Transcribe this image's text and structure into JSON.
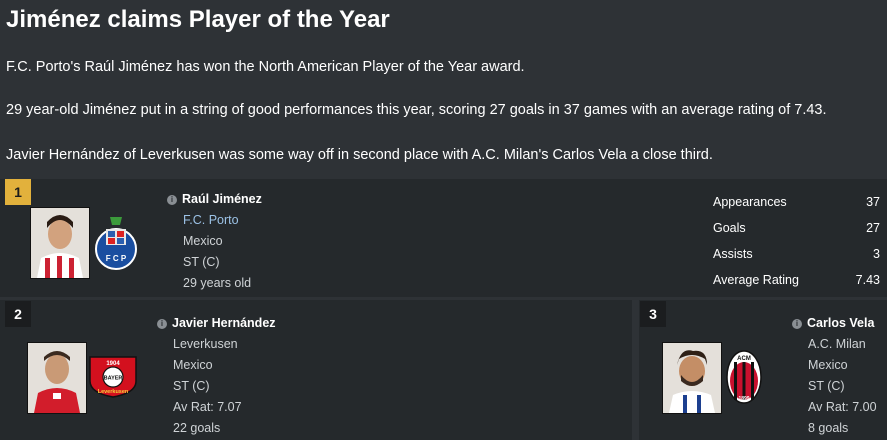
{
  "article": {
    "headline": "Jiménez claims Player of the Year",
    "paragraphs": [
      "F.C. Porto's Raúl Jiménez has won the North American Player of the Year award.",
      "29 year-old Jiménez put in a string of good performances this year, scoring 27 goals in 37 games with an average rating of 7.43.",
      "Javier Hernández of Leverkusen was some way off in second place with A.C. Milan's Carlos Vela a close third."
    ]
  },
  "winner": {
    "rank": "1",
    "name": "Raúl Jiménez",
    "club": "F.C. Porto",
    "nation": "Mexico",
    "position": "ST (C)",
    "age": "29 years old",
    "stats": [
      {
        "label": "Appearances",
        "value": "37"
      },
      {
        "label": "Goals",
        "value": "27"
      },
      {
        "label": "Assists",
        "value": "3"
      },
      {
        "label": "Average Rating",
        "value": "7.43"
      }
    ]
  },
  "second": {
    "rank": "2",
    "name": "Javier Hernández",
    "club": "Leverkusen",
    "nation": "Mexico",
    "position": "ST (C)",
    "rating": "Av Rat: 7.07",
    "goals": "22 goals"
  },
  "third": {
    "rank": "3",
    "name": "Carlos Vela",
    "club": "A.C. Milan",
    "nation": "Mexico",
    "position": "ST (C)",
    "rating": "Av Rat: 7.00",
    "goals": "8 goals"
  },
  "icons": {
    "info": "info-icon",
    "porto_crest": "porto-crest-icon",
    "leverkusen_crest": "leverkusen-crest-icon",
    "milan_crest": "milan-crest-icon"
  },
  "colors": {
    "background": "#2e3236",
    "panel": "#25292c",
    "gold": "#e2b13c",
    "link": "#9cc2e6"
  },
  "crest_text": {
    "porto_letters": "F C P",
    "leverkusen_top": "1904",
    "leverkusen_mid": "BAYER",
    "leverkusen_bottom": "Leverkusen",
    "milan_top": "ACM",
    "milan_year": "1899"
  }
}
